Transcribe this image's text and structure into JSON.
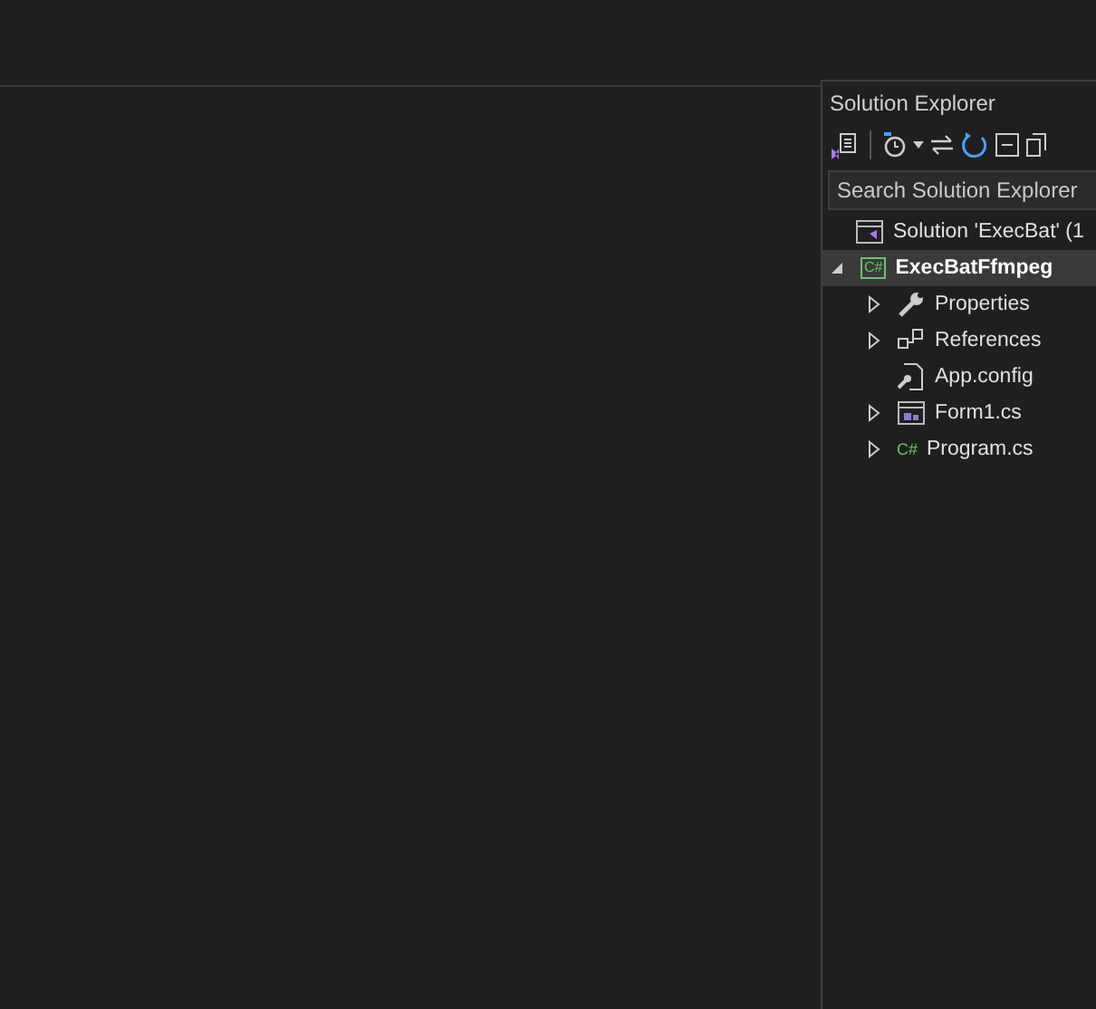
{
  "solution_explorer": {
    "title": "Solution Explorer",
    "toolbar": [
      {
        "kind": "switch-views"
      },
      {
        "kind": "separator"
      },
      {
        "kind": "history"
      },
      {
        "kind": "caret"
      },
      {
        "kind": "sync"
      },
      {
        "kind": "refresh"
      },
      {
        "kind": "collapse"
      },
      {
        "kind": "copy"
      }
    ],
    "search": {
      "placeholder": "Search Solution Explorer"
    },
    "tree": [
      {
        "label": "Solution 'ExecBat' (1",
        "kind": "solution",
        "selected": false,
        "children": [
          {
            "label": "ExecBatFfmpeg",
            "kind": "project",
            "icon_text": "C#",
            "selected": true,
            "expanded": true,
            "children": [
              {
                "label": "Properties",
                "kind": "properties",
                "selected": false,
                "expanded": false
              },
              {
                "label": "References",
                "kind": "references",
                "selected": false,
                "expanded": false
              },
              {
                "label": "App.config",
                "kind": "config",
                "selected": false
              },
              {
                "label": "Form1.cs",
                "kind": "form",
                "selected": false,
                "expanded": false
              },
              {
                "label": "Program.cs",
                "kind": "csharp",
                "icon_text": "C#",
                "selected": false,
                "expanded": false
              }
            ]
          }
        ]
      }
    ]
  }
}
